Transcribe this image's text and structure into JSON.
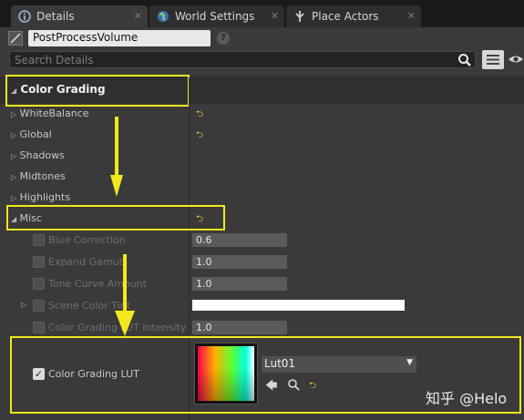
{
  "tabs": [
    {
      "label": "Details",
      "icon": "info-icon",
      "active": true
    },
    {
      "label": "World Settings",
      "icon": "globe-icon",
      "active": false
    },
    {
      "label": "Place Actors",
      "icon": "place-actors-icon",
      "active": false
    }
  ],
  "object_name": "PostProcessVolume",
  "search": {
    "placeholder": "Search Details"
  },
  "sections": {
    "color_grading": "Color Grading",
    "white_balance": "WhiteBalance",
    "global": "Global",
    "shadows": "Shadows",
    "midtones": "Midtones",
    "highlights": "Highlights",
    "misc": "Misc"
  },
  "properties": {
    "blue_correction": {
      "label": "Blue Correction",
      "value": "0.6"
    },
    "expand_gamut": {
      "label": "Expand Gamut",
      "value": "1.0"
    },
    "tone_curve_amount": {
      "label": "Tone Curve Amount",
      "value": "1.0"
    },
    "scene_color_tint": {
      "label": "Scene Color Tint",
      "color": "#ffffff"
    },
    "lut_intensity": {
      "label": "Color Grading LUT Intensity",
      "value": "1.0"
    },
    "lut": {
      "label": "Color Grading LUT",
      "checked": true,
      "asset": "Lut01"
    }
  },
  "watermark": "知乎 @Helo",
  "colors": {
    "highlight": "#f2e81e",
    "panel": "#3a3a3a"
  }
}
